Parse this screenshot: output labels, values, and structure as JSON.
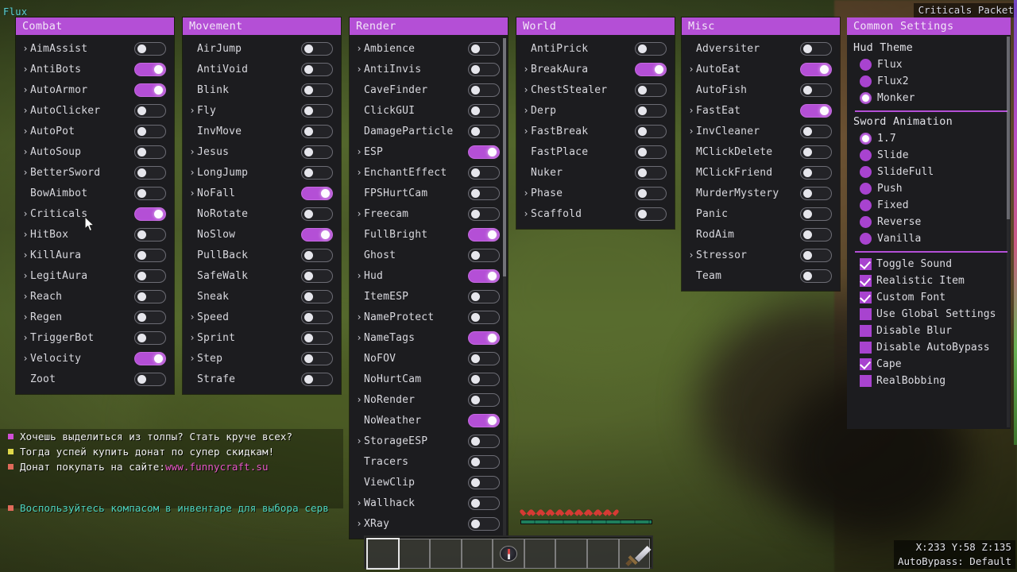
{
  "hud": {
    "watermark": "Flux",
    "arraylist": [
      "Criticals Packet"
    ],
    "coords": "X:233 Y:58 Z:135",
    "autobypass": "AutoBypass: Default"
  },
  "theme": {
    "accent": "#b44fd6",
    "panel_bg": "#1c1c1f",
    "text": "#d8d8de",
    "header_text": "#f3e6f8",
    "watermark_color": "#5ecfcf"
  },
  "panels": [
    {
      "title": "Combat",
      "modules": [
        {
          "name": "AimAssist",
          "expandable": true,
          "enabled": false
        },
        {
          "name": "AntiBots",
          "expandable": true,
          "enabled": true
        },
        {
          "name": "AutoArmor",
          "expandable": true,
          "enabled": true
        },
        {
          "name": "AutoClicker",
          "expandable": true,
          "enabled": false
        },
        {
          "name": "AutoPot",
          "expandable": true,
          "enabled": false
        },
        {
          "name": "AutoSoup",
          "expandable": true,
          "enabled": false
        },
        {
          "name": "BetterSword",
          "expandable": true,
          "enabled": false
        },
        {
          "name": "BowAimbot",
          "expandable": false,
          "enabled": false
        },
        {
          "name": "Criticals",
          "expandable": true,
          "enabled": true
        },
        {
          "name": "HitBox",
          "expandable": true,
          "enabled": false
        },
        {
          "name": "KillAura",
          "expandable": true,
          "enabled": false
        },
        {
          "name": "LegitAura",
          "expandable": true,
          "enabled": false
        },
        {
          "name": "Reach",
          "expandable": true,
          "enabled": false
        },
        {
          "name": "Regen",
          "expandable": true,
          "enabled": false
        },
        {
          "name": "TriggerBot",
          "expandable": true,
          "enabled": false
        },
        {
          "name": "Velocity",
          "expandable": true,
          "enabled": true
        },
        {
          "name": "Zoot",
          "expandable": false,
          "enabled": false
        }
      ]
    },
    {
      "title": "Movement",
      "modules": [
        {
          "name": "AirJump",
          "expandable": false,
          "enabled": false
        },
        {
          "name": "AntiVoid",
          "expandable": false,
          "enabled": false
        },
        {
          "name": "Blink",
          "expandable": false,
          "enabled": false
        },
        {
          "name": "Fly",
          "expandable": true,
          "enabled": false
        },
        {
          "name": "InvMove",
          "expandable": false,
          "enabled": false
        },
        {
          "name": "Jesus",
          "expandable": true,
          "enabled": false
        },
        {
          "name": "LongJump",
          "expandable": true,
          "enabled": false
        },
        {
          "name": "NoFall",
          "expandable": true,
          "enabled": true
        },
        {
          "name": "NoRotate",
          "expandable": false,
          "enabled": false
        },
        {
          "name": "NoSlow",
          "expandable": false,
          "enabled": true
        },
        {
          "name": "PullBack",
          "expandable": false,
          "enabled": false
        },
        {
          "name": "SafeWalk",
          "expandable": false,
          "enabled": false
        },
        {
          "name": "Sneak",
          "expandable": false,
          "enabled": false
        },
        {
          "name": "Speed",
          "expandable": true,
          "enabled": false
        },
        {
          "name": "Sprint",
          "expandable": true,
          "enabled": false
        },
        {
          "name": "Step",
          "expandable": true,
          "enabled": false
        },
        {
          "name": "Strafe",
          "expandable": false,
          "enabled": false
        }
      ]
    },
    {
      "title": "Render",
      "modules": [
        {
          "name": "Ambience",
          "expandable": true,
          "enabled": false
        },
        {
          "name": "AntiInvis",
          "expandable": true,
          "enabled": false
        },
        {
          "name": "CaveFinder",
          "expandable": false,
          "enabled": false
        },
        {
          "name": "ClickGUI",
          "expandable": false,
          "enabled": false
        },
        {
          "name": "DamageParticle",
          "expandable": false,
          "enabled": false
        },
        {
          "name": "ESP",
          "expandable": true,
          "enabled": true
        },
        {
          "name": "EnchantEffect",
          "expandable": true,
          "enabled": false
        },
        {
          "name": "FPSHurtCam",
          "expandable": false,
          "enabled": false
        },
        {
          "name": "Freecam",
          "expandable": true,
          "enabled": false
        },
        {
          "name": "FullBright",
          "expandable": false,
          "enabled": true
        },
        {
          "name": "Ghost",
          "expandable": false,
          "enabled": false
        },
        {
          "name": "Hud",
          "expandable": true,
          "enabled": true
        },
        {
          "name": "ItemESP",
          "expandable": false,
          "enabled": false
        },
        {
          "name": "NameProtect",
          "expandable": true,
          "enabled": false
        },
        {
          "name": "NameTags",
          "expandable": true,
          "enabled": true
        },
        {
          "name": "NoFOV",
          "expandable": false,
          "enabled": false
        },
        {
          "name": "NoHurtCam",
          "expandable": false,
          "enabled": false
        },
        {
          "name": "NoRender",
          "expandable": true,
          "enabled": false
        },
        {
          "name": "NoWeather",
          "expandable": false,
          "enabled": true
        },
        {
          "name": "StorageESP",
          "expandable": true,
          "enabled": false
        },
        {
          "name": "Tracers",
          "expandable": false,
          "enabled": false
        },
        {
          "name": "ViewClip",
          "expandable": false,
          "enabled": false
        },
        {
          "name": "Wallhack",
          "expandable": true,
          "enabled": false
        },
        {
          "name": "XRay",
          "expandable": true,
          "enabled": false
        }
      ]
    },
    {
      "title": "World",
      "modules": [
        {
          "name": "AntiPrick",
          "expandable": false,
          "enabled": false
        },
        {
          "name": "BreakAura",
          "expandable": true,
          "enabled": true
        },
        {
          "name": "ChestStealer",
          "expandable": true,
          "enabled": false
        },
        {
          "name": "Derp",
          "expandable": true,
          "enabled": false
        },
        {
          "name": "FastBreak",
          "expandable": true,
          "enabled": false
        },
        {
          "name": "FastPlace",
          "expandable": false,
          "enabled": false
        },
        {
          "name": "Nuker",
          "expandable": false,
          "enabled": false
        },
        {
          "name": "Phase",
          "expandable": true,
          "enabled": false
        },
        {
          "name": "Scaffold",
          "expandable": true,
          "enabled": false
        }
      ]
    },
    {
      "title": "Misc",
      "modules": [
        {
          "name": "Adversiter",
          "expandable": false,
          "enabled": false
        },
        {
          "name": "AutoEat",
          "expandable": true,
          "enabled": true
        },
        {
          "name": "AutoFish",
          "expandable": false,
          "enabled": false
        },
        {
          "name": "FastEat",
          "expandable": true,
          "enabled": true
        },
        {
          "name": "InvCleaner",
          "expandable": true,
          "enabled": false
        },
        {
          "name": "MClickDelete",
          "expandable": false,
          "enabled": false
        },
        {
          "name": "MClickFriend",
          "expandable": false,
          "enabled": false
        },
        {
          "name": "MurderMystery",
          "expandable": false,
          "enabled": false
        },
        {
          "name": "Panic",
          "expandable": false,
          "enabled": false
        },
        {
          "name": "RodAim",
          "expandable": false,
          "enabled": false
        },
        {
          "name": "Stressor",
          "expandable": true,
          "enabled": false
        },
        {
          "name": "Team",
          "expandable": false,
          "enabled": false
        }
      ]
    }
  ],
  "common_settings": {
    "title": "Common Settings",
    "sections": [
      {
        "label": "Hud Theme",
        "type": "radio",
        "options": [
          {
            "label": "Flux",
            "selected": false
          },
          {
            "label": "Flux2",
            "selected": false
          },
          {
            "label": "Monker",
            "selected": true
          }
        ]
      },
      {
        "label": "Sword Animation",
        "type": "radio",
        "options": [
          {
            "label": "1.7",
            "selected": true
          },
          {
            "label": "Slide",
            "selected": false
          },
          {
            "label": "SlideFull",
            "selected": false
          },
          {
            "label": "Push",
            "selected": false
          },
          {
            "label": "Fixed",
            "selected": false
          },
          {
            "label": "Reverse",
            "selected": false
          },
          {
            "label": "Vanilla",
            "selected": false
          }
        ]
      }
    ],
    "checkboxes": [
      {
        "label": "Toggle Sound",
        "checked": true
      },
      {
        "label": "Realistic Item",
        "checked": true
      },
      {
        "label": "Custom Font",
        "checked": true
      },
      {
        "label": "Use Global Settings",
        "checked": false
      },
      {
        "label": "Disable Blur",
        "checked": false
      },
      {
        "label": "Disable AutoBypass",
        "checked": false
      },
      {
        "label": "Cape",
        "checked": true
      },
      {
        "label": "RealBobbing",
        "checked": false
      }
    ]
  },
  "chat": {
    "lines": [
      {
        "bullet": "#d14fd6",
        "text": "Хочешь выделиться из толпы? Стать круче всех?",
        "color": "#f2f2f2"
      },
      {
        "bullet": "#e0d84a",
        "text": "Тогда успей купить донат по супер скидкам!",
        "color": "#f2f2f2"
      },
      {
        "bullet": "#e06a5a",
        "text": "Донат покупать на сайте: ",
        "color": "#f2f2f2",
        "link": "www.funnycraft.su",
        "link_color": "#e858c8"
      }
    ],
    "bottom_line": {
      "bullet": "#e06a5a",
      "text": "Воспользуйтесь компасом в инвентаре для выбора серв",
      "color": "#4fd6c0"
    }
  },
  "hotbar": {
    "slots": [
      {
        "index": 1,
        "item": "",
        "selected": true
      },
      {
        "index": 2,
        "item": "",
        "selected": false
      },
      {
        "index": 3,
        "item": "",
        "selected": false
      },
      {
        "index": 4,
        "item": "",
        "selected": false
      },
      {
        "index": 5,
        "item": "compass",
        "selected": false
      },
      {
        "index": 6,
        "item": "",
        "selected": false
      },
      {
        "index": 7,
        "item": "",
        "selected": false
      },
      {
        "index": 8,
        "item": "",
        "selected": false
      },
      {
        "index": 9,
        "item": "sword",
        "selected": false
      }
    ],
    "hearts": 10
  }
}
